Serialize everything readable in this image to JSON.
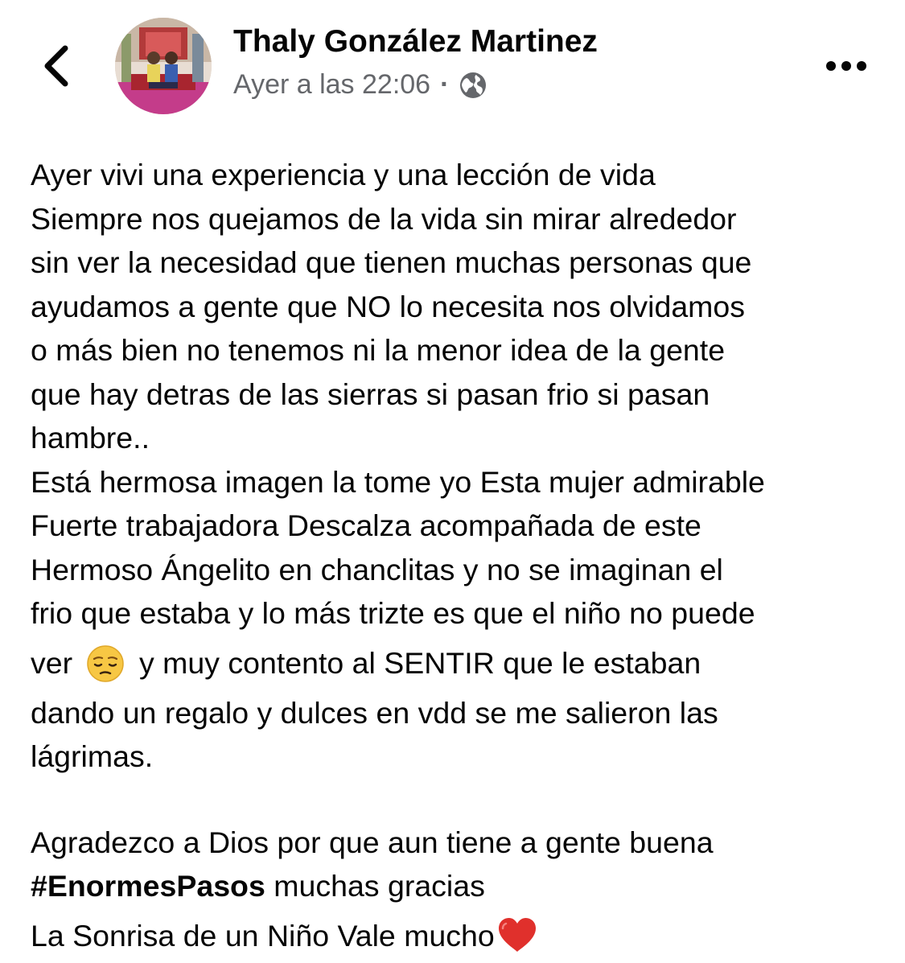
{
  "header": {
    "author_name": "Thaly González Martinez",
    "timestamp": "Ayer a las 22:06",
    "separator": "·",
    "privacy_icon": "globe-icon",
    "back_icon": "chevron-left-icon",
    "more_icon": "more-horizontal-icon"
  },
  "post": {
    "lines": [
      "Ayer vivi una experiencia y una lección de vida",
      "Siempre nos quejamos de la vida sin mirar alrededor",
      "sin ver la necesidad que tienen muchas personas que",
      "ayudamos a gente que NO lo necesita nos olvidamos",
      "o más bien no tenemos ni la menor idea de la gente",
      "que hay detras de las sierras si pasan frio si pasan",
      "hambre..",
      "Está hermosa imagen la tome yo Esta mujer admirable",
      "Fuerte trabajadora Descalza acompañada de este",
      "Hermoso Ángelito en chanclitas y no se imaginan el",
      "frio que estaba y lo más trizte es que el niño no puede"
    ],
    "emoji_line_before": "ver",
    "emoji_name": "pensive-face-emoji",
    "emoji_line_after": "y muy contento al SENTIR que le estaban",
    "lines_after_emoji": [
      "dando un regalo y dulces en vdd se me salieron las",
      "lágrimas."
    ],
    "thanks_line": "Agradezco a Dios por que aun tiene a gente buena",
    "hashtag": "#EnormesPasos",
    "hashtag_suffix": " muchas gracias",
    "final_line": "La Sonrisa de un Niño Vale mucho",
    "final_emoji": "red-heart-emoji"
  },
  "colors": {
    "text": "#050505",
    "secondary_text": "#65676b",
    "heart": "#e0302c",
    "emoji_yellow": "#f7c744"
  }
}
